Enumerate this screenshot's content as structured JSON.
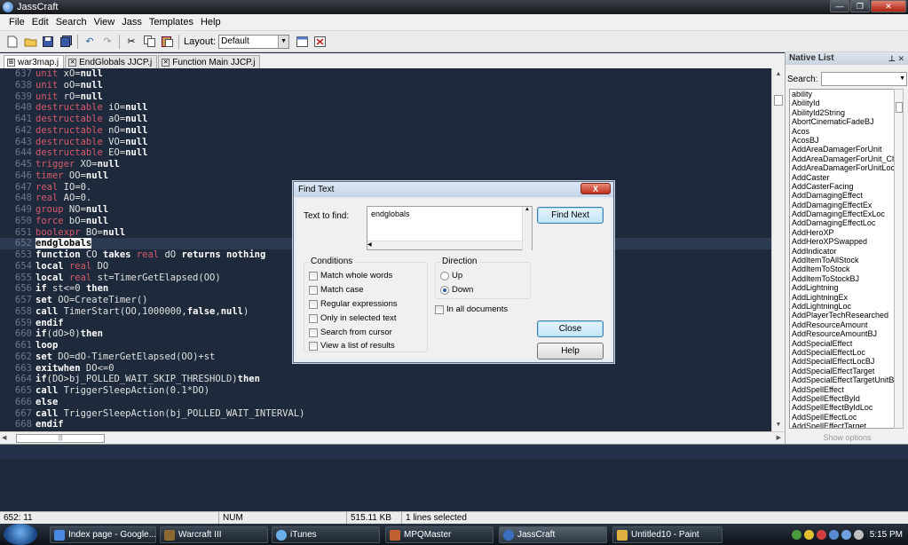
{
  "window": {
    "title": "JassCraft",
    "controls": [
      "—",
      "❐",
      "✕"
    ]
  },
  "menu": [
    "File",
    "Edit",
    "Search",
    "View",
    "Jass",
    "Templates",
    "Help"
  ],
  "toolbar": {
    "layout_label": "Layout:",
    "layout_value": "Default"
  },
  "tabs": [
    "war3map.j",
    "EndGlobals JJCP.j",
    "Function Main JJCP.j"
  ],
  "editor": {
    "lines": [
      {
        "n": "637",
        "type": "unit",
        "rest": " xO=",
        "kw": "null"
      },
      {
        "n": "638",
        "type": "unit",
        "rest": " oO=",
        "kw": "null"
      },
      {
        "n": "639",
        "type": "unit",
        "rest": " rO=",
        "kw": "null"
      },
      {
        "n": "640",
        "type": "destructable",
        "rest": " iO=",
        "kw": "null"
      },
      {
        "n": "641",
        "type": "destructable",
        "rest": " aO=",
        "kw": "null"
      },
      {
        "n": "642",
        "type": "destructable",
        "rest": " nO=",
        "kw": "null"
      },
      {
        "n": "643",
        "type": "destructable",
        "rest": " VO=",
        "kw": "null"
      },
      {
        "n": "644",
        "type": "destructable",
        "rest": " EO=",
        "kw": "null"
      },
      {
        "n": "645",
        "type": "trigger",
        "rest": " XO=",
        "kw": "null"
      },
      {
        "n": "646",
        "type": "timer",
        "rest": " OO=",
        "kw": "null"
      },
      {
        "n": "647",
        "type": "real",
        "rest": " IO=0.",
        "kw": ""
      },
      {
        "n": "648",
        "type": "real",
        "rest": " AO=0.",
        "kw": ""
      },
      {
        "n": "649",
        "type": "group",
        "rest": " NO=",
        "kw": "null"
      },
      {
        "n": "650",
        "type": "force",
        "rest": " bO=",
        "kw": "null"
      },
      {
        "n": "651",
        "type": "boolexpr",
        "rest": " BO=",
        "kw": "null"
      },
      {
        "n": "652",
        "type": "",
        "rest": "",
        "kw": "",
        "hl": "endglobals"
      },
      {
        "n": "653",
        "type": "",
        "rest": "",
        "kw": "",
        "raw": "function CO takes real dO returns nothing"
      },
      {
        "n": "654",
        "type": "",
        "rest": "",
        "kw": "",
        "raw": "local real DO"
      },
      {
        "n": "655",
        "type": "",
        "rest": "",
        "kw": "",
        "raw": "local real st=TimerGetElapsed(OO)"
      },
      {
        "n": "656",
        "type": "",
        "rest": "",
        "kw": "",
        "raw": "if st<=0 then"
      },
      {
        "n": "657",
        "type": "",
        "rest": "",
        "kw": "",
        "raw": "set OO=CreateTimer()"
      },
      {
        "n": "658",
        "type": "",
        "rest": "",
        "kw": "",
        "raw": "call TimerStart(OO,1000000,false,null)"
      },
      {
        "n": "659",
        "type": "",
        "rest": "",
        "kw": "",
        "raw": "endif"
      },
      {
        "n": "660",
        "type": "",
        "rest": "",
        "kw": "",
        "raw": "if(dO>0)then"
      },
      {
        "n": "661",
        "type": "",
        "rest": "",
        "kw": "",
        "raw": "loop"
      },
      {
        "n": "662",
        "type": "",
        "rest": "",
        "kw": "",
        "raw": "set DO=dO-TimerGetElapsed(OO)+st"
      },
      {
        "n": "663",
        "type": "",
        "rest": "",
        "kw": "",
        "raw": "exitwhen DO<=0"
      },
      {
        "n": "664",
        "type": "",
        "rest": "",
        "kw": "",
        "raw": "if(DO>bj_POLLED_WAIT_SKIP_THRESHOLD)then"
      },
      {
        "n": "665",
        "type": "",
        "rest": "",
        "kw": "",
        "raw": "call TriggerSleepAction(0.1*DO)"
      },
      {
        "n": "666",
        "type": "",
        "rest": "",
        "kw": "",
        "raw": "else"
      },
      {
        "n": "667",
        "type": "",
        "rest": "",
        "kw": "",
        "raw": "call TriggerSleepAction(bj_POLLED_WAIT_INTERVAL)"
      },
      {
        "n": "668",
        "type": "",
        "rest": "",
        "kw": "",
        "raw": "endif"
      }
    ]
  },
  "native_list": {
    "title": "Native List",
    "search_label": "Search:",
    "show_options": "Show options",
    "items": [
      "ability",
      "AbilityId",
      "AbilityId2String",
      "AbortCinematicFadeBJ",
      "Acos",
      "AcosBJ",
      "AddAreaDamagerForUnit",
      "AddAreaDamagerForUnit_Chi",
      "AddAreaDamagerForUnitLoc",
      "AddCaster",
      "AddCasterFacing",
      "AddDamagingEffect",
      "AddDamagingEffectEx",
      "AddDamagingEffectExLoc",
      "AddDamagingEffectLoc",
      "AddHeroXP",
      "AddHeroXPSwapped",
      "AddIndicator",
      "AddItemToAllStock",
      "AddItemToStock",
      "AddItemToStockBJ",
      "AddLightning",
      "AddLightningEx",
      "AddLightningLoc",
      "AddPlayerTechResearched",
      "AddResourceAmount",
      "AddResourceAmountBJ",
      "AddSpecialEffect",
      "AddSpecialEffectLoc",
      "AddSpecialEffectLocBJ",
      "AddSpecialEffectTarget",
      "AddSpecialEffectTargetUnitBJ",
      "AddSpellEffect",
      "AddSpellEffectById",
      "AddSpellEffectByIdLoc",
      "AddSpellEffectLoc",
      "AddSpellEffectTarget"
    ]
  },
  "dialog": {
    "title": "Find Text",
    "close_x": "X",
    "find_label": "Text to find:",
    "find_value": "endglobals",
    "find_next": "Find Next",
    "close": "Close",
    "help": "Help",
    "conditions_title": "Conditions",
    "conditions": [
      "Match whole words",
      "Match case",
      "Regular expressions",
      "Only in selected text",
      "Search from cursor",
      "View a list of results"
    ],
    "direction_title": "Direction",
    "up": "Up",
    "down": "Down",
    "all_docs": "In all documents"
  },
  "status": {
    "position": "652: 11",
    "num": "NUM",
    "size": "515.11 KB",
    "selection": "1 lines selected"
  },
  "taskbar": {
    "tasks": [
      "Index page - Google...",
      "Warcraft III",
      "iTunes",
      "MPQMaster",
      "JassCraft",
      "Untitled10 - Paint"
    ],
    "clock": "5:15 PM"
  },
  "colors": {
    "editor_bg": "#1e2a3c",
    "type_keyword": "#d65a6a",
    "line_number": "#6a7890"
  }
}
